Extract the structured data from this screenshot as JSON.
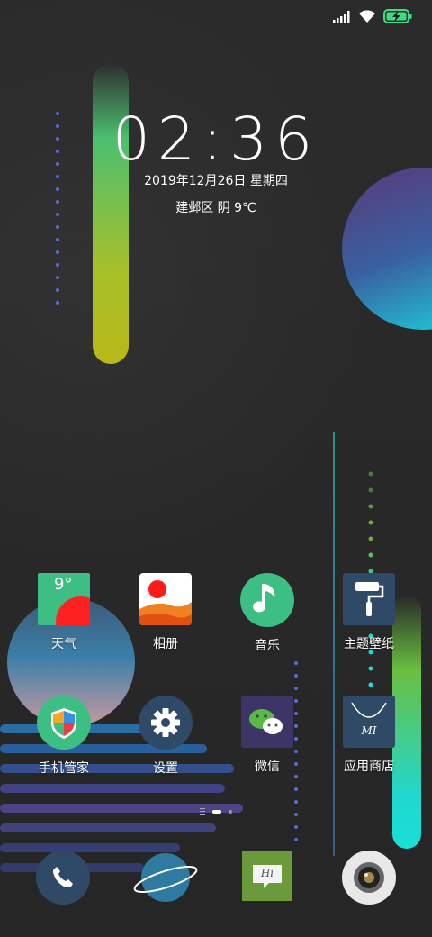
{
  "status": {
    "signal_icon": "signal-bars-icon",
    "wifi_icon": "wifi-icon",
    "battery_icon": "battery-charging-icon",
    "battery_color": "#3ddc84"
  },
  "lockscreen": {
    "time": "02:36",
    "date": "2019年12月26日  星期四",
    "weather": "建邺区    阴    9℃"
  },
  "weather_widget_temp": "9°",
  "apps": [
    {
      "label": "天气",
      "icon": "weather-icon"
    },
    {
      "label": "相册",
      "icon": "gallery-icon"
    },
    {
      "label": "音乐",
      "icon": "music-icon"
    },
    {
      "label": "主题壁纸",
      "icon": "theme-paint-roller-icon"
    },
    {
      "label": "手机管家",
      "icon": "security-shield-icon"
    },
    {
      "label": "设置",
      "icon": "settings-gear-icon"
    },
    {
      "label": "微信",
      "icon": "wechat-icon"
    },
    {
      "label": "应用商店",
      "icon": "app-store-bag-icon"
    }
  ],
  "dock": [
    {
      "icon": "phone-icon"
    },
    {
      "icon": "browser-planet-icon"
    },
    {
      "icon": "messages-icon",
      "text": "Hi"
    },
    {
      "icon": "camera-icon"
    }
  ],
  "store_icon_text": "MI",
  "colors": {
    "accent_green": "#3dbf84",
    "teal": "#22d8d0",
    "yellow_green": "#b8c020"
  }
}
